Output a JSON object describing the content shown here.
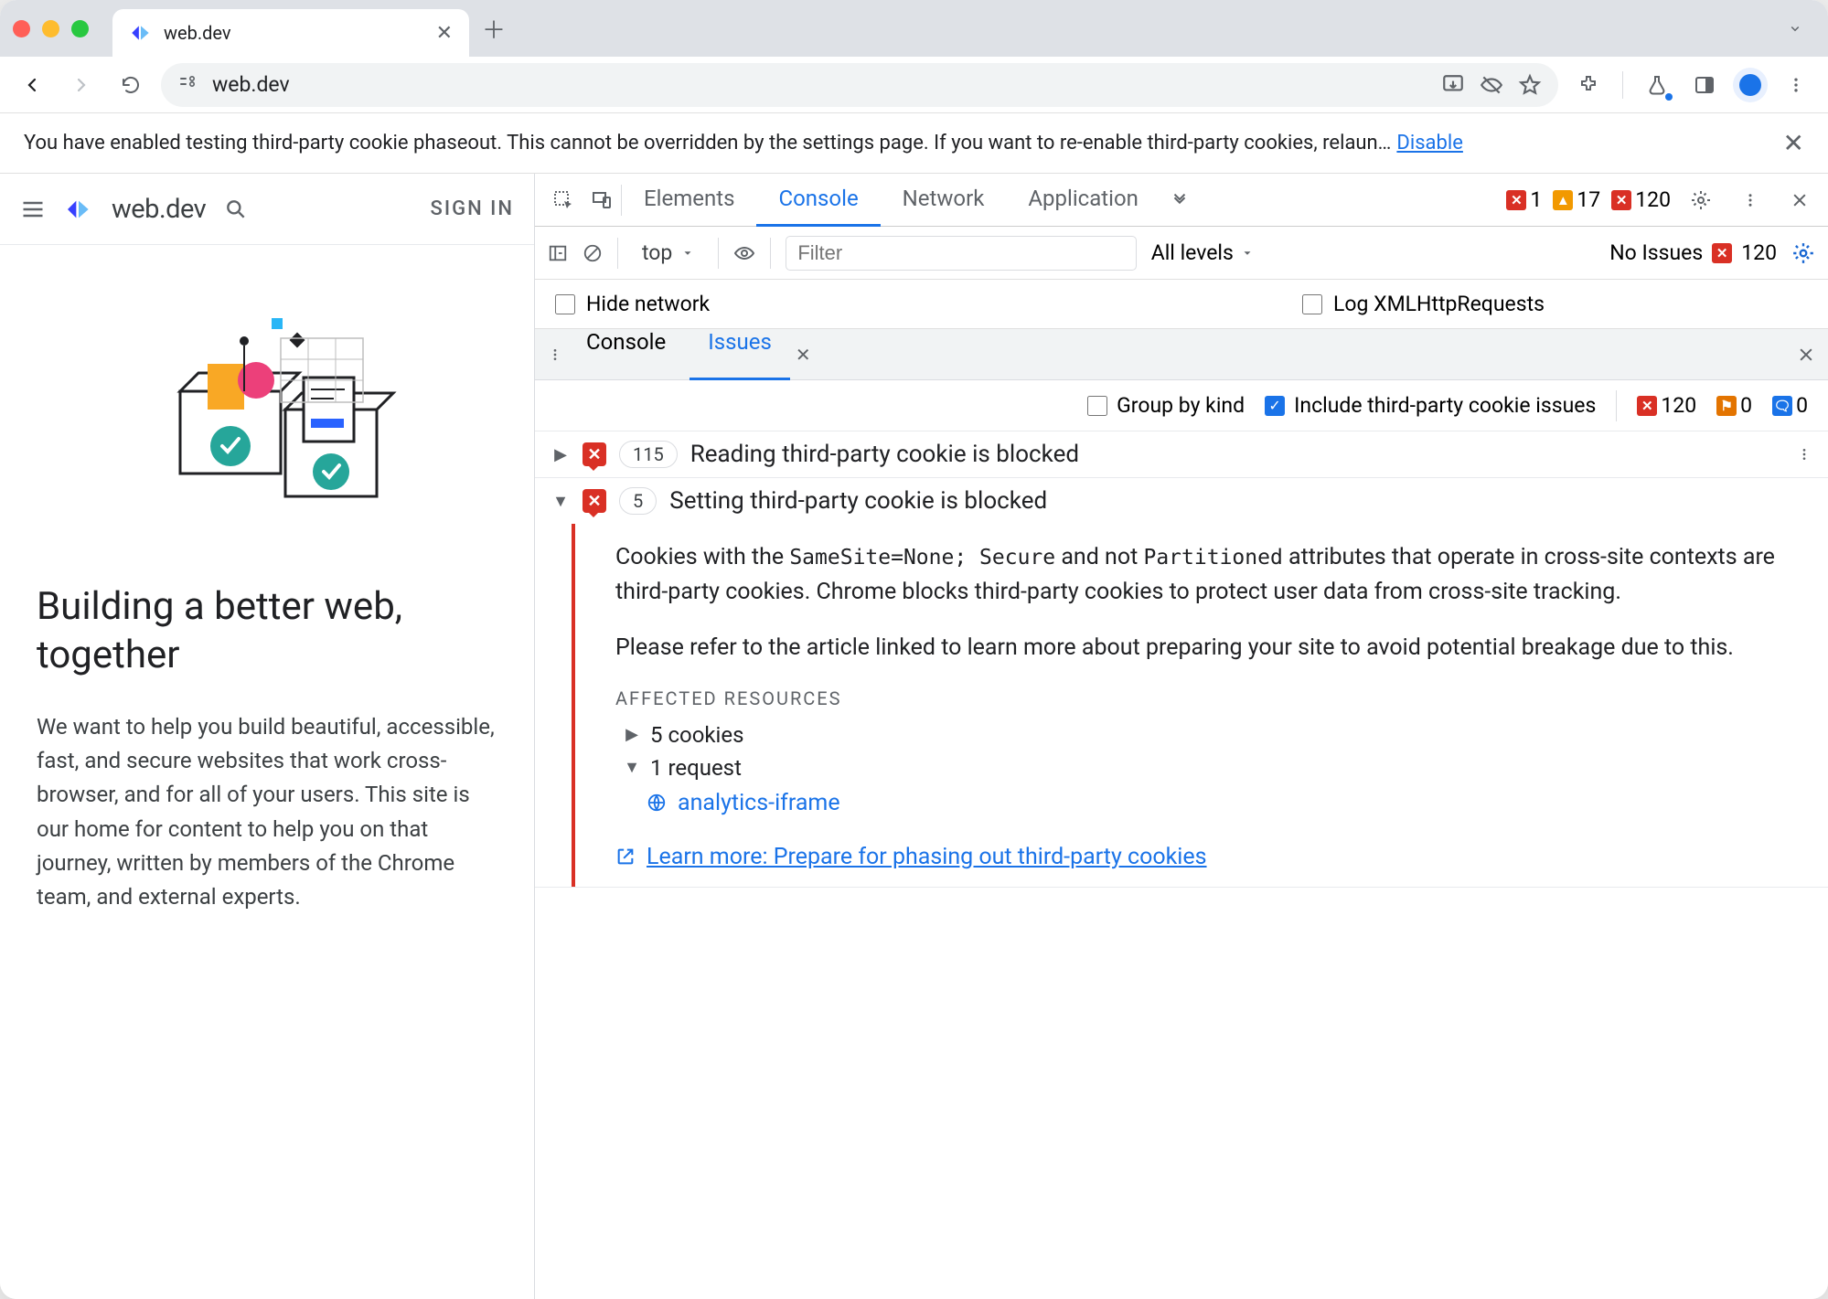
{
  "browser": {
    "tab_title": "web.dev",
    "url": "web.dev"
  },
  "banner": {
    "text": "You have enabled testing third-party cookie phaseout. This cannot be overridden by the settings page. If you want to re-enable third-party cookies, relaun…",
    "link": "Disable"
  },
  "page": {
    "logo_text": "web.dev",
    "signin": "SIGN IN",
    "hero_title": "Building a better web, together",
    "hero_body": "We want to help you build beautiful, accessible, fast, and secure websites that work cross-browser, and for all of your users. This site is our home for content to help you on that journey, written by members of the Chrome team, and external experts."
  },
  "devtools": {
    "tabs": [
      "Elements",
      "Console",
      "Network",
      "Application"
    ],
    "active_tab": "Console",
    "error_count": "1",
    "warn_count": "17",
    "crossx_count": "120",
    "context_dropdown": "top",
    "filter_placeholder": "Filter",
    "levels_dropdown": "All levels",
    "no_issues_text": "No Issues",
    "no_issues_count": "120",
    "hide_network": "Hide network",
    "log_xhr": "Log XMLHttpRequests",
    "drawer_tabs": [
      "Console",
      "Issues"
    ],
    "drawer_active": "Issues",
    "group_by_kind": "Group by kind",
    "include_3p": "Include third-party cookie issues",
    "badge_err": "120",
    "badge_warn": "0",
    "badge_info": "0",
    "issues": [
      {
        "count": "115",
        "title": "Reading third-party cookie is blocked",
        "expanded": false
      },
      {
        "count": "5",
        "title": "Setting third-party cookie is blocked",
        "expanded": true,
        "body_p1_pre": "Cookies with the ",
        "body_p1_code1": "SameSite=None; Secure",
        "body_p1_mid": " and not ",
        "body_p1_code2": "Partitioned",
        "body_p1_post": " attributes that operate in cross-site contexts are third-party cookies. Chrome blocks third-party cookies to protect user data from cross-site tracking.",
        "body_p2": "Please refer to the article linked to learn more about preparing your site to avoid potential breakage due to this.",
        "affected_heading": "AFFECTED RESOURCES",
        "affected": [
          {
            "label": "5 cookies",
            "open": false
          },
          {
            "label": "1 request",
            "open": true,
            "children": [
              "analytics-iframe"
            ]
          }
        ],
        "learn_more": "Learn more: Prepare for phasing out third-party cookies"
      }
    ]
  }
}
